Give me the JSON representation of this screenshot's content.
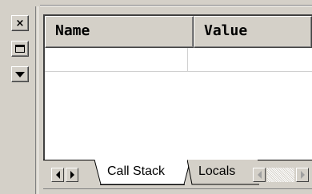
{
  "columns": {
    "name": "Name",
    "value": "Value"
  },
  "tabs": {
    "call_stack": "Call Stack",
    "locals": "Locals"
  },
  "window_buttons": {
    "close_glyph": "×"
  },
  "icons": {
    "close": "close-icon",
    "restore": "restore-icon",
    "menu": "dropdown-arrow-icon",
    "scroll_left": "arrow-left-icon",
    "scroll_right": "arrow-right-icon"
  },
  "colors": {
    "face": "#d4d0c8",
    "shadow": "#808080",
    "dark_shadow": "#404040",
    "highlight": "#ffffff",
    "text": "#000000"
  }
}
